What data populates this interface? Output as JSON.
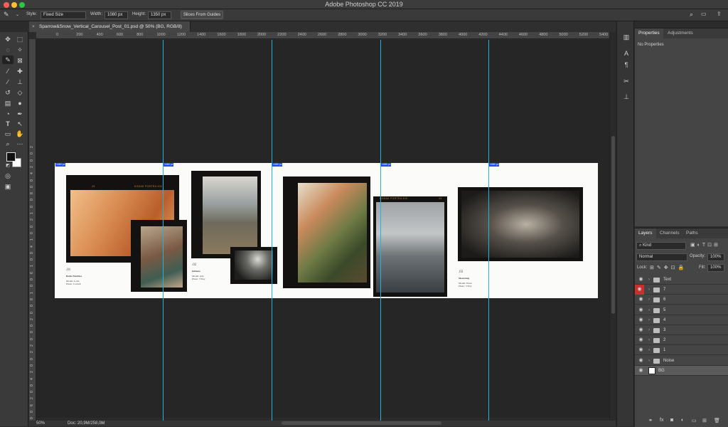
{
  "window": {
    "title": "Adobe Photoshop CC 2019"
  },
  "options": {
    "style_label": "Style:",
    "style_value": "Fixed Size",
    "width_label": "Width:",
    "width_value": "1080 px",
    "height_label": "Height:",
    "height_value": "1350 px",
    "slices_button": "Slices From Guides"
  },
  "document": {
    "tab_title": "Sparrow&Snow_Vertical_Carousel_Post_01.psd @ 50% (BG, RGB/8)"
  },
  "ruler": {
    "h_ticks": [
      "0",
      "200",
      "400",
      "600",
      "800",
      "1000",
      "1200",
      "1400",
      "1600",
      "1800",
      "2000",
      "2200",
      "2400",
      "2600",
      "2800",
      "3000",
      "3200",
      "3400",
      "3600",
      "3800",
      "4000",
      "4200",
      "4400",
      "4600",
      "4800",
      "5000",
      "5200",
      "5400"
    ],
    "v_ticks": [
      "2",
      "0",
      "0",
      "2",
      "4",
      "0",
      "0",
      "8",
      "0",
      "0",
      "1",
      "2",
      "0",
      "0",
      "1",
      "4",
      "0",
      "0",
      "1",
      "6",
      "0",
      "0",
      "1",
      "8",
      "0",
      "0",
      "2",
      "0",
      "0",
      "0",
      "2",
      "2",
      "0",
      "0",
      "2",
      "4",
      "0",
      "0",
      "2",
      "6",
      "0",
      "0"
    ]
  },
  "guides": {
    "tag_label": "1080 px"
  },
  "film": {
    "brand": "KODAK PORTRA 400",
    "frame_number": "43"
  },
  "captions": [
    {
      "number": ".01",
      "title": "Bettie Marbles",
      "line1": "Model: Lolla",
      "line2": "Photo: Cornell"
    },
    {
      "number": ".02",
      "title": "Inflame",
      "line1": "Model: Ady",
      "line2": "Photo: TTray"
    },
    {
      "number": ".03",
      "title": "Mourning",
      "line1": "Model: Wren",
      "line2": "Photo: TTray"
    }
  ],
  "status": {
    "zoom": "50%",
    "doc_info": "Doc: 20,9M/258,0M"
  },
  "properties": {
    "tab_properties": "Properties",
    "tab_adjustments": "Adjustments",
    "empty_text": "No Properties"
  },
  "layers": {
    "tab_layers": "Layers",
    "tab_channels": "Channels",
    "tab_paths": "Paths",
    "filter_kind": "Kind",
    "blend_mode": "Normal",
    "opacity_label": "Opacity:",
    "opacity_value": "100%",
    "lock_label": "Lock:",
    "fill_label": "Fill:",
    "fill_value": "100%",
    "items": [
      {
        "name": "Text",
        "type": "folder",
        "highlight": false
      },
      {
        "name": "7",
        "type": "folder",
        "highlight": true
      },
      {
        "name": "6",
        "type": "folder",
        "highlight": false
      },
      {
        "name": "5",
        "type": "folder",
        "highlight": false
      },
      {
        "name": "4",
        "type": "folder",
        "highlight": false
      },
      {
        "name": "3",
        "type": "folder",
        "highlight": false
      },
      {
        "name": "2",
        "type": "folder",
        "highlight": false
      },
      {
        "name": "1",
        "type": "folder",
        "highlight": false
      },
      {
        "name": "Noise",
        "type": "folder",
        "highlight": false
      },
      {
        "name": "BG",
        "type": "layer",
        "highlight": false,
        "selected": true
      }
    ]
  },
  "colors": {
    "accent": "#19b7e0",
    "guide_tag": "#1e47ff",
    "eye_highlight": "#c9302c",
    "film_text": "#d47b2c"
  }
}
